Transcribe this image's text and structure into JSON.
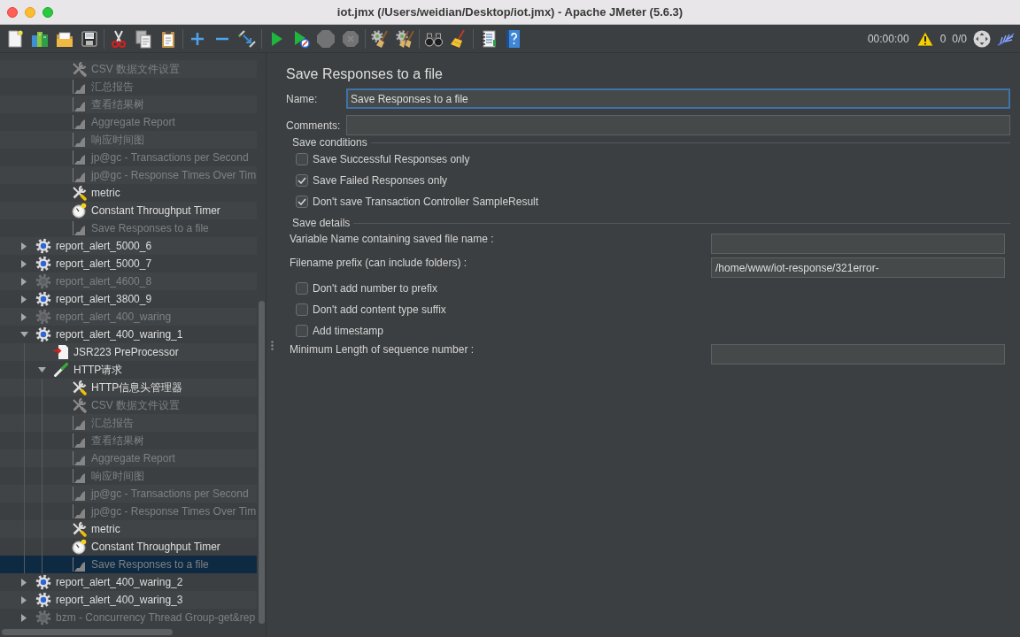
{
  "window": {
    "title": "iot.jmx (/Users/weidian/Desktop/iot.jmx) - Apache JMeter (5.6.3)"
  },
  "toolbar": {
    "groups": [
      [
        {
          "kind": "new",
          "disabled": false
        },
        {
          "kind": "templates",
          "disabled": false
        },
        {
          "kind": "open",
          "disabled": false
        },
        {
          "kind": "save",
          "disabled": false
        }
      ],
      [
        {
          "kind": "cut",
          "disabled": false
        },
        {
          "kind": "copy",
          "disabled": false
        },
        {
          "kind": "paste",
          "disabled": false
        }
      ],
      [
        {
          "kind": "expand",
          "disabled": false
        },
        {
          "kind": "collapse",
          "disabled": false
        },
        {
          "kind": "toggle",
          "disabled": false
        }
      ],
      [
        {
          "kind": "start",
          "disabled": false
        },
        {
          "kind": "start_no_pauses",
          "disabled": false
        },
        {
          "kind": "stop",
          "disabled": true
        },
        {
          "kind": "shutdown",
          "disabled": true
        }
      ],
      [
        {
          "kind": "clear",
          "disabled": false
        },
        {
          "kind": "clear_all",
          "disabled": false
        }
      ],
      [
        {
          "kind": "search",
          "disabled": false
        },
        {
          "kind": "reset_search",
          "disabled": false
        }
      ],
      [
        {
          "kind": "function_helper",
          "disabled": false
        },
        {
          "kind": "help",
          "disabled": false
        }
      ]
    ],
    "status": {
      "elapsed": "00:00:00",
      "errors": "0",
      "threads": "0/0"
    }
  },
  "tree": {
    "continued_items": [
      {
        "label": "CSV 数据文件设置",
        "kind": "config",
        "disabled": true,
        "selected": false
      },
      {
        "label": "汇总报告",
        "kind": "listener",
        "disabled": true,
        "selected": false
      },
      {
        "label": "查看结果树",
        "kind": "listener",
        "disabled": true,
        "selected": false
      },
      {
        "label": "Aggregate Report",
        "kind": "listener",
        "disabled": true,
        "selected": false
      },
      {
        "label": "响应时间图",
        "kind": "listener",
        "disabled": true,
        "selected": false
      },
      {
        "label": "jp@gc - Transactions per Second",
        "kind": "listener",
        "disabled": true,
        "selected": false
      },
      {
        "label": "jp@gc - Response Times Over Tim",
        "kind": "listener",
        "disabled": true,
        "selected": false
      },
      {
        "label": "metric",
        "kind": "config",
        "disabled": false,
        "selected": false
      },
      {
        "label": "Constant Throughput Timer",
        "kind": "timer",
        "disabled": false,
        "selected": false
      },
      {
        "label": "Save Responses to a file",
        "kind": "listener",
        "disabled": true,
        "selected": false
      }
    ],
    "items": [
      {
        "label": "report_alert_5000_6",
        "kind": "thread_group",
        "disabled": false,
        "selected": false,
        "expanded": false
      },
      {
        "label": "report_alert_5000_7",
        "kind": "thread_group",
        "disabled": false,
        "selected": false,
        "expanded": false
      },
      {
        "label": "report_alert_4600_8",
        "kind": "thread_group",
        "disabled": true,
        "selected": false,
        "expanded": false
      },
      {
        "label": "report_alert_3800_9",
        "kind": "thread_group",
        "disabled": false,
        "selected": false,
        "expanded": false
      },
      {
        "label": "report_alert_400_waring",
        "kind": "thread_group",
        "disabled": true,
        "selected": false,
        "expanded": false
      },
      {
        "label": "report_alert_400_waring_1",
        "kind": "thread_group",
        "disabled": false,
        "selected": false,
        "expanded": true,
        "children": [
          {
            "label": "JSR223 PreProcessor",
            "kind": "preprocessor",
            "disabled": false,
            "selected": false
          },
          {
            "label": "HTTP请求",
            "kind": "sampler",
            "disabled": false,
            "selected": false,
            "expanded": true,
            "children": [
              {
                "label": "HTTP信息头管理器",
                "kind": "config",
                "disabled": false,
                "selected": false
              },
              {
                "label": "CSV 数据文件设置",
                "kind": "config",
                "disabled": true,
                "selected": false
              },
              {
                "label": "汇总报告",
                "kind": "listener",
                "disabled": true,
                "selected": false
              },
              {
                "label": "查看结果树",
                "kind": "listener",
                "disabled": true,
                "selected": false
              },
              {
                "label": "Aggregate Report",
                "kind": "listener",
                "disabled": true,
                "selected": false
              },
              {
                "label": "响应时间图",
                "kind": "listener",
                "disabled": true,
                "selected": false
              },
              {
                "label": "jp@gc - Transactions per Second",
                "kind": "listener",
                "disabled": true,
                "selected": false
              },
              {
                "label": "jp@gc - Response Times Over Tim",
                "kind": "listener",
                "disabled": true,
                "selected": false
              },
              {
                "label": "metric",
                "kind": "config",
                "disabled": false,
                "selected": false
              },
              {
                "label": "Constant Throughput Timer",
                "kind": "timer",
                "disabled": false,
                "selected": false
              },
              {
                "label": "Save Responses to a file",
                "kind": "listener",
                "disabled": true,
                "selected": true
              }
            ]
          }
        ]
      },
      {
        "label": "report_alert_400_waring_2",
        "kind": "thread_group",
        "disabled": false,
        "selected": false,
        "expanded": false
      },
      {
        "label": "report_alert_400_waring_3",
        "kind": "thread_group",
        "disabled": false,
        "selected": false,
        "expanded": false
      },
      {
        "label": "bzm - Concurrency Thread Group-get&rep",
        "kind": "thread_group",
        "disabled": true,
        "selected": false,
        "expanded": false
      }
    ]
  },
  "editor": {
    "title": "Save Responses to a file",
    "fields": [
      {
        "label": "Name:",
        "value": "Save Responses to a file",
        "focused": true
      },
      {
        "label": "Comments:",
        "focused": false
      }
    ],
    "sections": [
      {
        "title": "Save conditions",
        "rows": [
          {
            "kind": "checkbox",
            "label": "Save Successful Responses only",
            "checked": false
          },
          {
            "kind": "checkbox",
            "label": "Save Failed Responses only",
            "checked": true
          },
          {
            "kind": "checkbox",
            "label": "Don't save Transaction Controller SampleResult",
            "checked": true
          }
        ]
      },
      {
        "title": "Save details",
        "rows": [
          {
            "kind": "field",
            "label": "Variable Name containing saved file name :"
          },
          {
            "kind": "field",
            "label": "Filename prefix (can include folders) :",
            "value": "/home/www/iot-response/321error-"
          },
          {
            "kind": "checkbox",
            "label": "Don't add number to prefix",
            "checked": false
          },
          {
            "kind": "checkbox",
            "label": "Don't add content type suffix",
            "checked": false
          },
          {
            "kind": "checkbox",
            "label": "Add timestamp",
            "checked": false
          },
          {
            "kind": "field",
            "label": "Minimum Length of sequence number :"
          }
        ]
      }
    ]
  }
}
